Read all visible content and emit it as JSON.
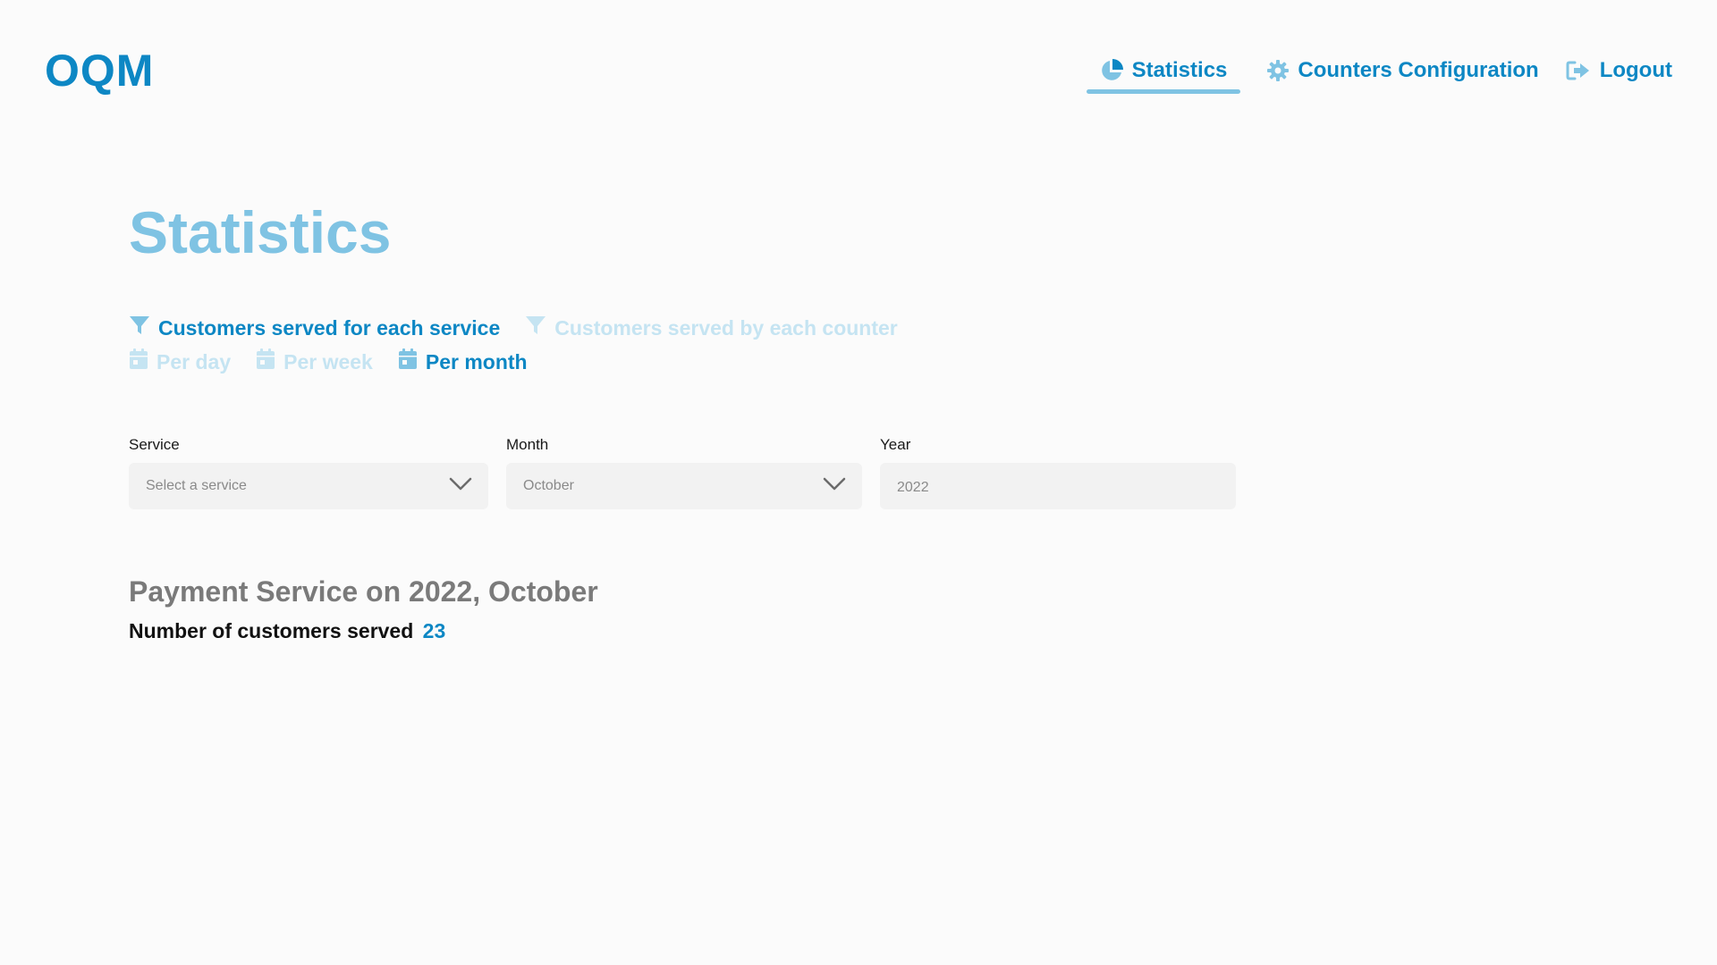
{
  "app": {
    "logo": "OQM"
  },
  "nav": {
    "statistics": "Statistics",
    "counters": "Counters Configuration",
    "logout": "Logout"
  },
  "page": {
    "title": "Statistics"
  },
  "filters": {
    "by_service": "Customers served for each service",
    "by_counter": "Customers served by each counter",
    "per_day": "Per day",
    "per_week": "Per week",
    "per_month": "Per month"
  },
  "form": {
    "service_label": "Service",
    "service_value": "Select a service",
    "month_label": "Month",
    "month_value": "October",
    "year_label": "Year",
    "year_value": "2022"
  },
  "result": {
    "title": "Payment Service on 2022, October",
    "count_label": "Number of customers served",
    "count": "23"
  },
  "colors": {
    "brand": "#0d87c4",
    "title_light": "#7fc3e3",
    "inactive": "#c5e4f2"
  },
  "icons": [
    "pie-chart-icon",
    "gear-icon",
    "logout-icon",
    "filter-icon",
    "calendar-icon",
    "chevron-down-icon"
  ]
}
